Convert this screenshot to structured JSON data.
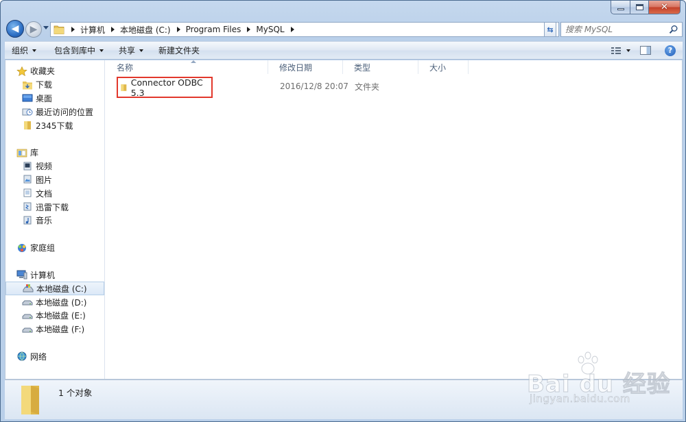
{
  "window": {
    "caption": {
      "minimize": "",
      "maximize": "",
      "close": "✕"
    }
  },
  "address": {
    "crumbs": [
      "计算机",
      "本地磁盘 (C:)",
      "Program Files",
      "MySQL"
    ]
  },
  "search": {
    "placeholder": "搜索 MySQL"
  },
  "toolbar": {
    "organize": "组织",
    "include_in_library": "包含到库中",
    "share": "共享",
    "new_folder": "新建文件夹"
  },
  "sidebar": {
    "favorites": {
      "label": "收藏夹",
      "items": [
        "下载",
        "桌面",
        "最近访问的位置",
        "2345下载"
      ]
    },
    "libraries": {
      "label": "库",
      "items": [
        "视频",
        "图片",
        "文档",
        "迅雷下载",
        "音乐"
      ]
    },
    "homegroup": {
      "label": "家庭组"
    },
    "computer": {
      "label": "计算机",
      "items": [
        "本地磁盘 (C:)",
        "本地磁盘 (D:)",
        "本地磁盘 (E:)",
        "本地磁盘 (F:)"
      ]
    },
    "network": {
      "label": "网络"
    }
  },
  "columns": {
    "name": "名称",
    "modified": "修改日期",
    "type": "类型",
    "size": "大小"
  },
  "files": [
    {
      "name": "Connector ODBC 5.3",
      "modified": "2016/12/8 20:07",
      "type": "文件夹",
      "size": ""
    }
  ],
  "details": {
    "count": "1 个对象"
  },
  "watermark": {
    "logo": "Bai du 经验",
    "url": "jingyan.baidu.com"
  },
  "colors": {
    "highlight_border": "#e2372b",
    "folder": "#e8c55a",
    "accent": "#2d6fc4"
  }
}
